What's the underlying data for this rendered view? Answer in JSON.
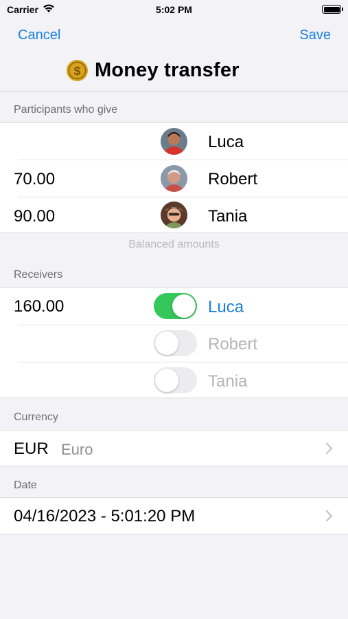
{
  "status_bar": {
    "carrier": "Carrier",
    "time": "5:02 PM"
  },
  "nav": {
    "cancel_label": "Cancel",
    "save_label": "Save",
    "title": "Money transfer"
  },
  "givers": {
    "header": "Participants who give",
    "rows": [
      {
        "amount": "",
        "name": "Luca"
      },
      {
        "amount": "70.00",
        "name": "Robert"
      },
      {
        "amount": "90.00",
        "name": "Tania"
      }
    ],
    "footer": "Balanced amounts"
  },
  "receivers": {
    "header": "Receivers",
    "rows": [
      {
        "amount": "160.00",
        "name": "Luca",
        "enabled": true
      },
      {
        "amount": "",
        "name": "Robert",
        "enabled": false
      },
      {
        "amount": "",
        "name": "Tania",
        "enabled": false
      }
    ]
  },
  "currency": {
    "header": "Currency",
    "code": "EUR",
    "name": "Euro"
  },
  "date": {
    "header": "Date",
    "value": "04/16/2023 - 5:01:20 PM"
  },
  "colors": {
    "accent": "#1a7fe0",
    "toggle_on": "#34c759",
    "coin": "#d8a21c"
  }
}
